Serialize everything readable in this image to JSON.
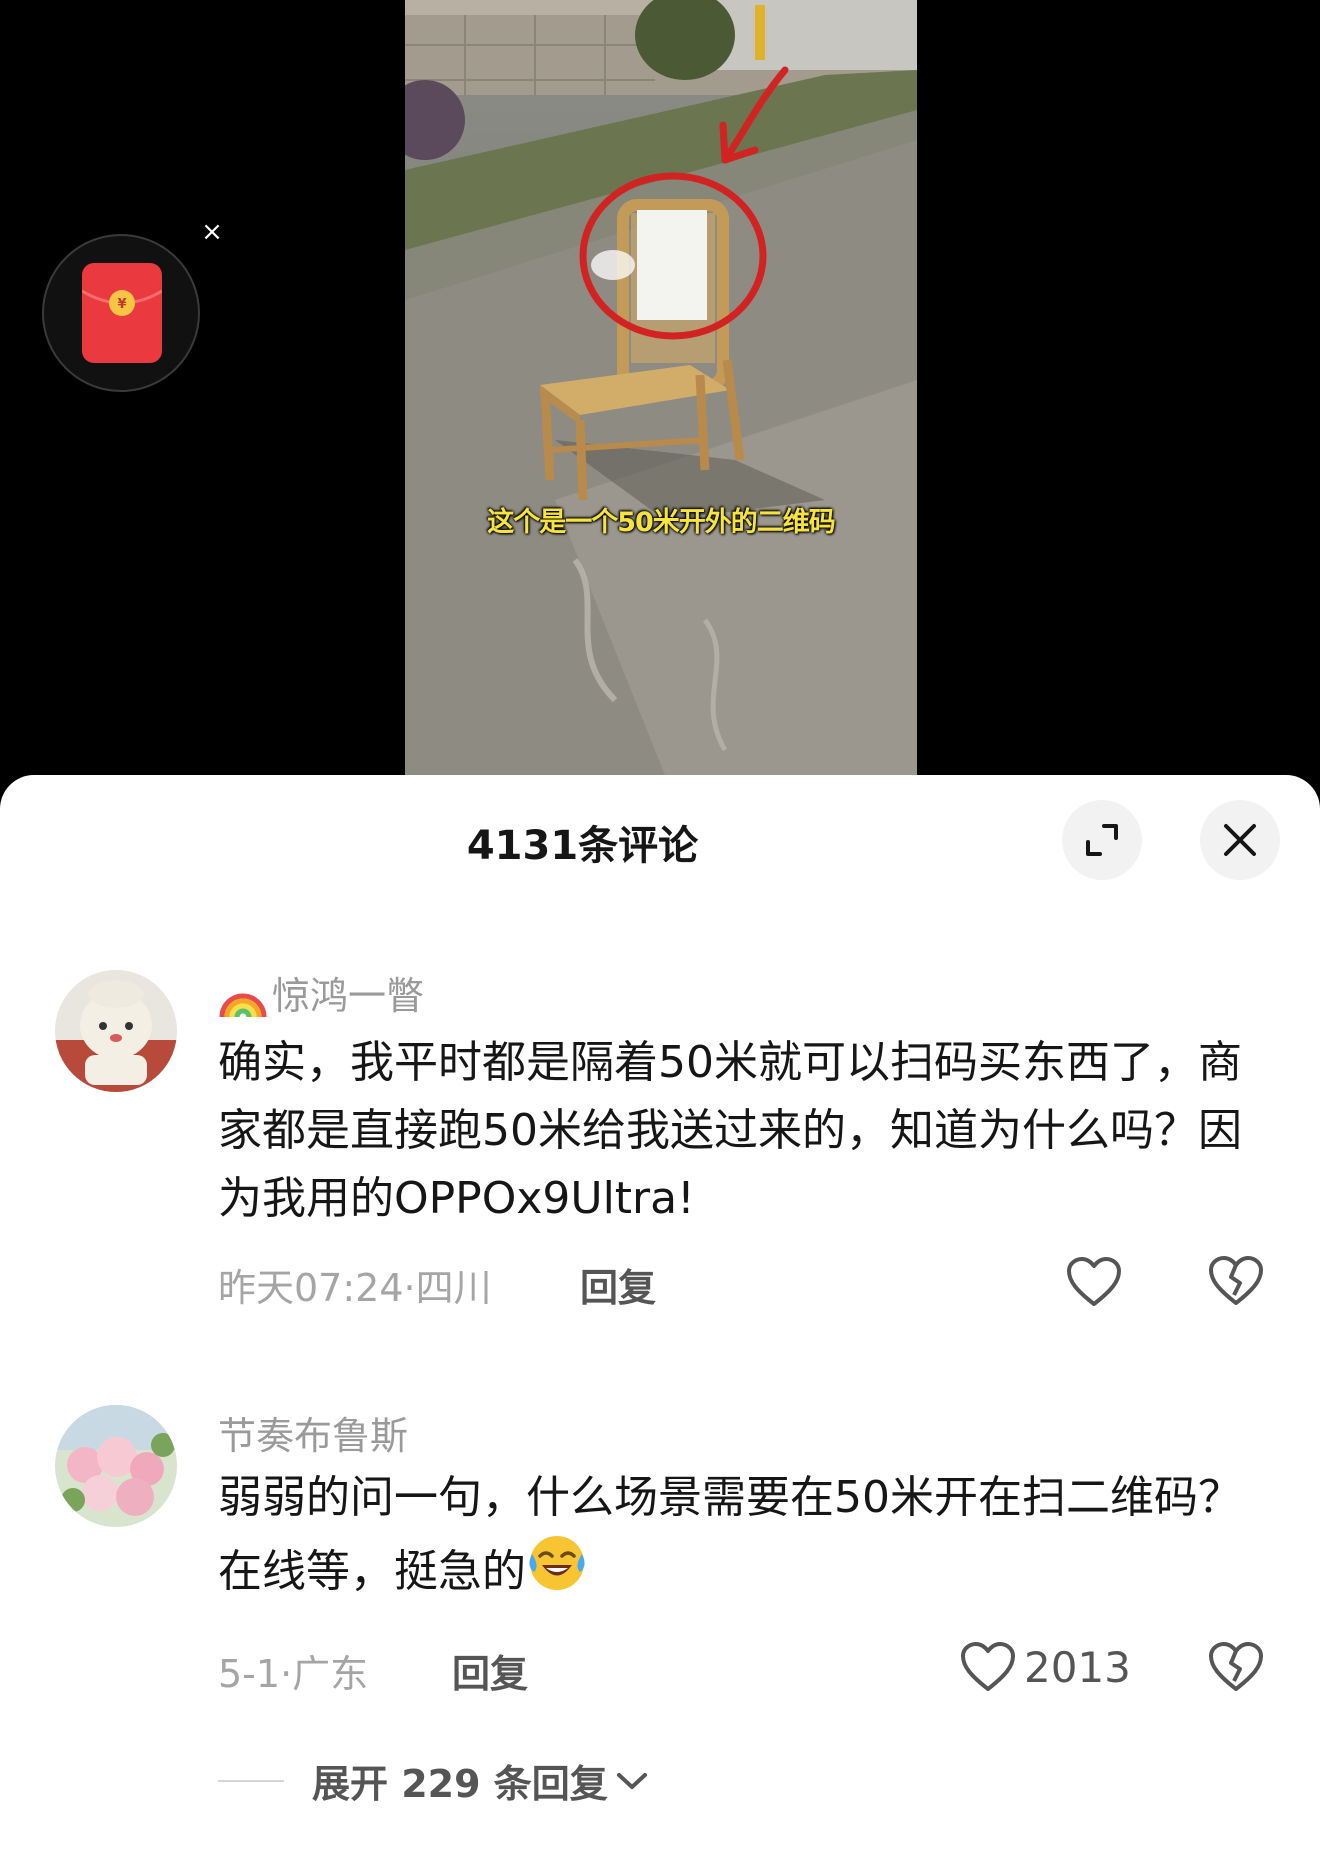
{
  "video": {
    "subtitle": "这个是一个50米开外的二维码"
  },
  "red_packet": {
    "icon": "red-envelope-icon",
    "close_icon": "close-icon"
  },
  "comments_panel": {
    "title": "4131条评论",
    "expand_icon": "expand-icon",
    "close_icon": "close-icon",
    "comments": [
      {
        "username": "惊鸿一瞥",
        "username_prefix_icon": "rainbow-icon",
        "text": "确实，我平时都是隔着50米就可以扫码买东西了，商家都是直接跑50米给我送过来的，知道为什么吗？因为我用的OPPOx9Ultra!",
        "meta": "昨天07:24·四川",
        "reply_label": "回复",
        "like_count": ""
      },
      {
        "username": "节奏布鲁斯",
        "text": "弱弱的问一句，什么场景需要在50米开在扫二维码？在线等，挺急的",
        "text_suffix_icon": "laughing-crying-emoji-icon",
        "meta": "5-1·广东",
        "reply_label": "回复",
        "like_count": "2013",
        "expand_replies_label": "展开 229 条回复"
      }
    ]
  },
  "colors": {
    "sheet_bg": "#ffffff",
    "text_primary": "#161616",
    "text_secondary": "#a5a5a5",
    "subtitle": "#f6e33d",
    "red_packet": "#e8343a"
  }
}
